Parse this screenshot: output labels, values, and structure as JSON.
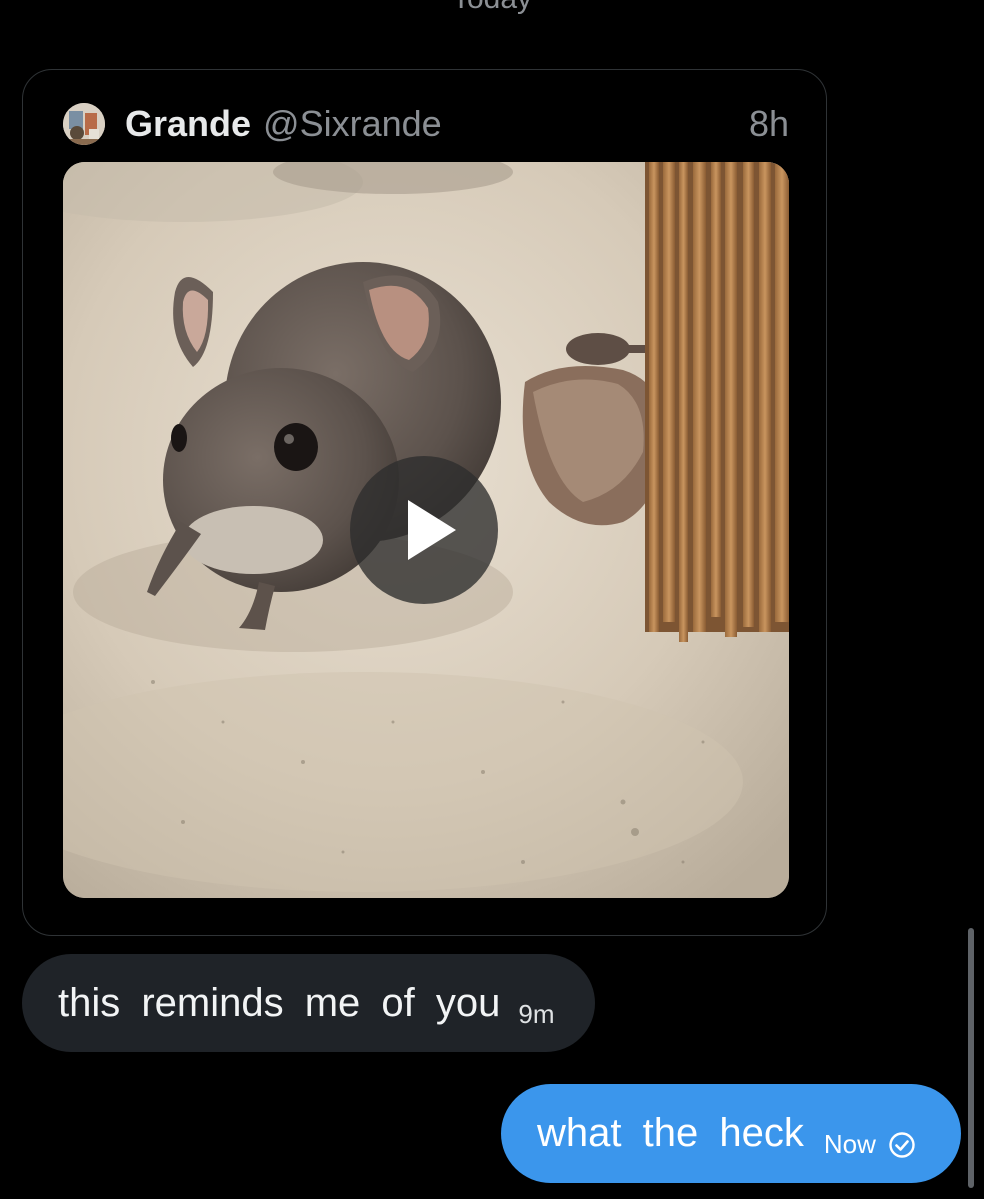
{
  "conversation": {
    "date_divider": "Today"
  },
  "shared_post": {
    "author_name": "Grande",
    "author_handle": "@Sixrande",
    "timestamp": "8h",
    "media": {
      "type": "video",
      "subject": "small-mouse-in-sand"
    }
  },
  "messages": [
    {
      "direction": "received",
      "text": "this reminds me of you",
      "time": "9m"
    },
    {
      "direction": "sent",
      "text": "what the heck",
      "time": "Now",
      "status_icon": "sent-check-icon"
    }
  ],
  "colors": {
    "background": "#000000",
    "received_bubble": "#1f2328",
    "sent_bubble": "#3b96ec",
    "card_border": "#2f3336",
    "muted_text": "#8b8f94"
  }
}
